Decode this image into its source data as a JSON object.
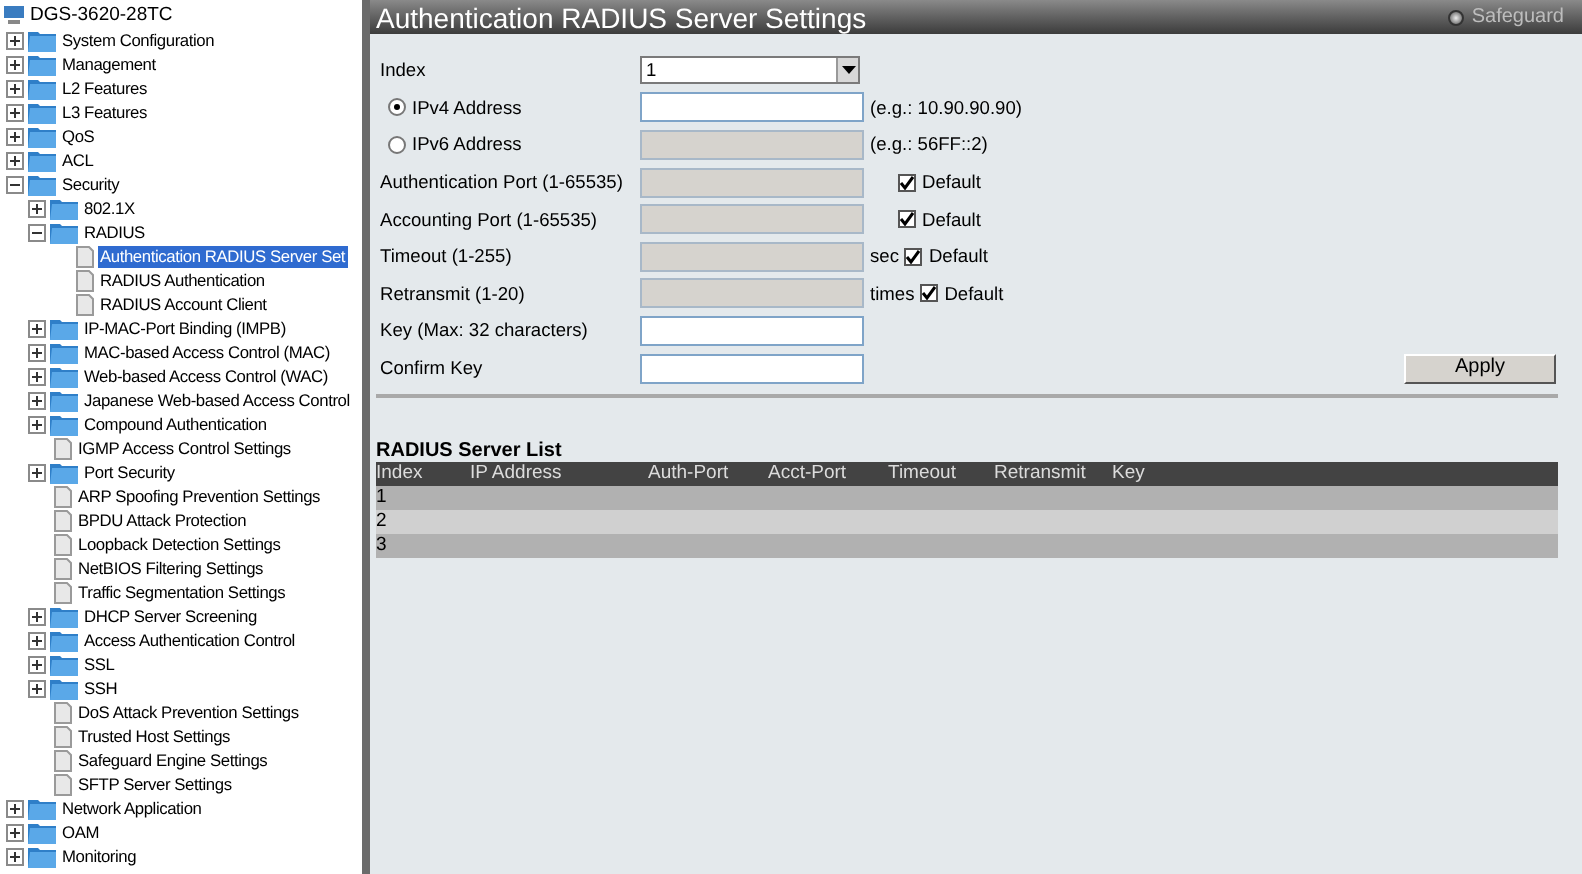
{
  "tree": {
    "label": "DGS-3620-28TC",
    "children": [
      {
        "label": "System Configuration",
        "kind": "folder",
        "expanded": false,
        "selected": false
      },
      {
        "label": "Management",
        "kind": "folder",
        "expanded": false,
        "selected": false
      },
      {
        "label": "L2 Features",
        "kind": "folder",
        "expanded": false,
        "selected": false
      },
      {
        "label": "L3 Features",
        "kind": "folder",
        "expanded": false,
        "selected": false
      },
      {
        "label": "QoS",
        "kind": "folder",
        "expanded": false,
        "selected": false
      },
      {
        "label": "ACL",
        "kind": "folder",
        "expanded": false,
        "selected": false
      },
      {
        "label": "Security",
        "kind": "folder",
        "expanded": true,
        "selected": false,
        "children": [
          {
            "label": "802.1X",
            "kind": "folder",
            "expanded": false,
            "selected": false
          },
          {
            "label": "RADIUS",
            "kind": "folder",
            "expanded": true,
            "selected": false,
            "children": [
              {
                "label": "Authentication RADIUS Server Set",
                "kind": "page",
                "selected": true
              },
              {
                "label": "RADIUS Authentication",
                "kind": "page",
                "selected": false
              },
              {
                "label": "RADIUS Account Client",
                "kind": "page",
                "selected": false
              }
            ]
          },
          {
            "label": "IP-MAC-Port Binding (IMPB)",
            "kind": "folder",
            "expanded": false,
            "selected": false
          },
          {
            "label": "MAC-based Access Control (MAC)",
            "kind": "folder",
            "expanded": false,
            "selected": false
          },
          {
            "label": "Web-based Access Control (WAC)",
            "kind": "folder",
            "expanded": false,
            "selected": false
          },
          {
            "label": "Japanese Web-based Access Control",
            "kind": "folder",
            "expanded": false,
            "selected": false
          },
          {
            "label": "Compound Authentication",
            "kind": "folder",
            "expanded": false,
            "selected": false
          },
          {
            "label": "IGMP Access Control Settings",
            "kind": "page",
            "selected": false
          },
          {
            "label": "Port Security",
            "kind": "folder",
            "expanded": false,
            "selected": false
          },
          {
            "label": "ARP Spoofing Prevention Settings",
            "kind": "page",
            "selected": false
          },
          {
            "label": "BPDU Attack Protection",
            "kind": "page",
            "selected": false
          },
          {
            "label": "Loopback Detection Settings",
            "kind": "page",
            "selected": false
          },
          {
            "label": "NetBIOS Filtering Settings",
            "kind": "page",
            "selected": false
          },
          {
            "label": "Traffic Segmentation Settings",
            "kind": "page",
            "selected": false
          },
          {
            "label": "DHCP Server Screening",
            "kind": "folder",
            "expanded": false,
            "selected": false
          },
          {
            "label": "Access Authentication Control",
            "kind": "folder",
            "expanded": false,
            "selected": false
          },
          {
            "label": "SSL",
            "kind": "folder",
            "expanded": false,
            "selected": false
          },
          {
            "label": "SSH",
            "kind": "folder",
            "expanded": false,
            "selected": false
          },
          {
            "label": "DoS Attack Prevention Settings",
            "kind": "page",
            "selected": false
          },
          {
            "label": "Trusted Host Settings",
            "kind": "page",
            "selected": false
          },
          {
            "label": "Safeguard Engine Settings",
            "kind": "page",
            "selected": false
          },
          {
            "label": "SFTP Server Settings",
            "kind": "page",
            "selected": false
          }
        ]
      },
      {
        "label": "Network Application",
        "kind": "folder",
        "expanded": false,
        "selected": false
      },
      {
        "label": "OAM",
        "kind": "folder",
        "expanded": false,
        "selected": false
      },
      {
        "label": "Monitoring",
        "kind": "folder",
        "expanded": false,
        "selected": false
      }
    ]
  },
  "header": {
    "title": "Authentication RADIUS Server Settings",
    "safeguard": "Safeguard"
  },
  "form": {
    "rows": [
      {
        "kind": "select",
        "label": "Index",
        "value": "1"
      },
      {
        "kind": "radio",
        "label": "IPv4 Address",
        "selected": true,
        "disabled": false,
        "hint": "(e.g.: 10.90.90.90)"
      },
      {
        "kind": "radio",
        "label": "IPv6 Address",
        "selected": false,
        "disabled": true,
        "hint": "(e.g.: 56FF::2)"
      },
      {
        "kind": "text",
        "label": "Authentication Port (1-65535)",
        "disabled": true,
        "default": {
          "label": "Default",
          "checked": true
        }
      },
      {
        "kind": "text",
        "label": "Accounting Port (1-65535)",
        "disabled": true,
        "default": {
          "label": "Default",
          "checked": true
        }
      },
      {
        "kind": "text",
        "label": "Timeout (1-255)",
        "disabled": true,
        "unit": "sec",
        "default": {
          "label": "Default",
          "checked": true
        }
      },
      {
        "kind": "text",
        "label": "Retransmit (1-20)",
        "disabled": true,
        "unit": "times",
        "default": {
          "label": "Default",
          "checked": true
        }
      },
      {
        "kind": "text",
        "label": "Key (Max: 32 characters)",
        "disabled": false
      },
      {
        "kind": "text",
        "label": "Confirm Key",
        "disabled": false
      }
    ],
    "apply": "Apply"
  },
  "table": {
    "title": "RADIUS Server List",
    "columns": [
      "Index",
      "IP Address",
      "Auth-Port",
      "Acct-Port",
      "Timeout",
      "Retransmit",
      "Key"
    ],
    "rows": [
      [
        "1"
      ],
      [
        "2"
      ],
      [
        "3"
      ]
    ]
  }
}
